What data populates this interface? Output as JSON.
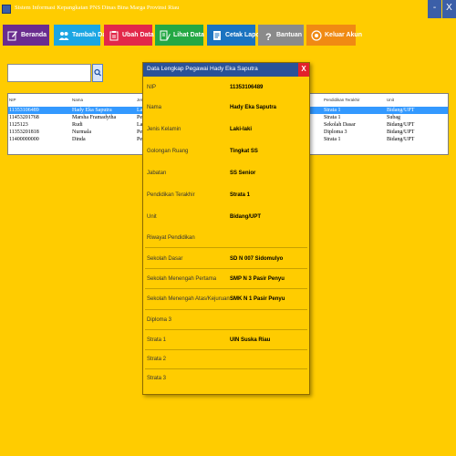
{
  "window": {
    "title": "Sistem Informasi Kepangkatan PNS Dinas Bina Marga Provinsi Riau",
    "minimize_glyph": "-",
    "close_glyph": "X"
  },
  "toolbar": {
    "beranda": "Beranda",
    "tambah_data": "Tambah Data",
    "ubah_data": "Ubah Data",
    "lihat_data": "Lihat Data",
    "cetak_laporan": "Cetak Laporan",
    "bantuan": "Bantuan",
    "keluar_akun": "Keluar Akun"
  },
  "search": {
    "value": ""
  },
  "table": {
    "columns": [
      "NIP",
      "Nama",
      "Jenis",
      "Pendidikan Terakhir",
      "Unit"
    ],
    "rows": [
      {
        "nip": "11353106489",
        "nama": "Hady Eka Saputra",
        "jenis": "Laki",
        "pendidikan": "Strata 1",
        "unit": "Bidang/UPT",
        "selected": true
      },
      {
        "nip": "11453201768",
        "nama": "Marsha Framadytha",
        "jenis": "Pere",
        "pendidikan": "Strata 1",
        "unit": "Subag",
        "selected": false
      },
      {
        "nip": "1125123",
        "nama": "Rudi",
        "jenis": "Laki",
        "pendidikan": "Sekolah Dasar",
        "unit": "Bidang/UPT",
        "selected": false
      },
      {
        "nip": "11353201818",
        "nama": "Nurmala",
        "jenis": "Pere",
        "pendidikan": "Diploma 3",
        "unit": "Bidang/UPT",
        "selected": false
      },
      {
        "nip": "11400000000",
        "nama": "Dinda",
        "jenis": "Pere",
        "pendidikan": "Strata 1",
        "unit": "Bidang/UPT",
        "selected": false
      }
    ]
  },
  "detail": {
    "title": "Data Lengkap Pegawai Hady Eka Saputra",
    "close_glyph": "X",
    "fields": [
      {
        "label": "NIP",
        "value": "11353106489"
      },
      {
        "label": "Nama",
        "value": "Hady Eka Saputra"
      },
      {
        "label": "Jenis Kelamin",
        "value": "Laki-laki"
      },
      {
        "label": "Golongan Ruang",
        "value": "Tingkat SS"
      },
      {
        "label": "Jabatan",
        "value": "SS Senior"
      },
      {
        "label": "Pendidikan Terakhir",
        "value": "Strata 1"
      },
      {
        "label": "Unit",
        "value": "Bidang/UPT"
      }
    ],
    "riwayat_label": "Riwayat Pendidikan",
    "education": [
      {
        "label": "Sekolah Dasar",
        "value": "SD N 007 Sidomulyo"
      },
      {
        "label": "Sekolah Menengah Pertama",
        "value": "SMP N 3 Pasir Penyu"
      },
      {
        "label": "Sekolah Menengah Atas/Kejuruan",
        "value": "SMK N 1 Pasir Penyu"
      },
      {
        "label": "Diploma 3",
        "value": ""
      },
      {
        "label": "Strata 1",
        "value": "UIN Suska Riau"
      },
      {
        "label": "Strata 2",
        "value": ""
      },
      {
        "label": "Strata 3",
        "value": ""
      }
    ]
  },
  "colors": {
    "background": "#FFCC00",
    "title_bar_accent": "#2A5298",
    "selection": "#3399FF",
    "close_red": "#E3212B"
  },
  "icons": {
    "beranda": "edit-pencil-icon",
    "tambah_data": "people-icon",
    "ubah_data": "clipboard-icon",
    "lihat_data": "document-pen-icon",
    "cetak_laporan": "report-icon",
    "bantuan": "question-icon",
    "keluar_akun": "power-icon",
    "search": "search-icon"
  }
}
